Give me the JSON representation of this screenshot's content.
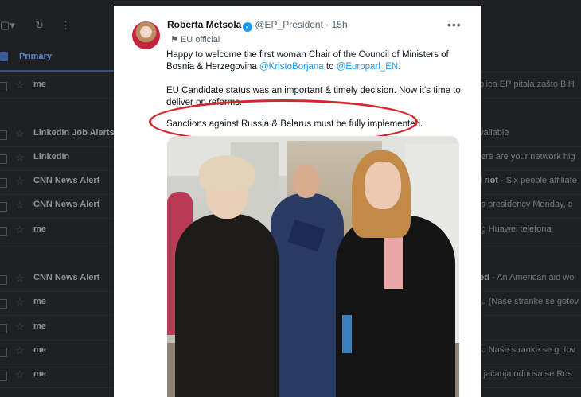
{
  "gmail": {
    "tab_primary": "Primary",
    "rows": [
      {
        "sender": "me",
        "snippet": "ablica EP pitala zašto BiH"
      },
      {
        "sender": "LinkedIn Job Alerts",
        "snippet": "available"
      },
      {
        "sender": "LinkedIn",
        "snippet": "Here are your network hig"
      },
      {
        "sender": "CNN News Alert",
        "snippet_bold": "al riot",
        "snippet": " - Six people affiliate"
      },
      {
        "sender": "CNN News Alert",
        "snippet": "his presidency Monday, c"
      },
      {
        "sender": "me",
        "snippet": "log Huawei telefona"
      },
      {
        "sender": "CNN News Alert",
        "snippet_bold": "eed",
        "snippet": " - An American aid wo"
      },
      {
        "sender": "me",
        "snippet": "blu (Naše stranke se gotov"
      },
      {
        "sender": "me",
        "snippet": ""
      },
      {
        "sender": "me",
        "snippet": "blu Naše stranke se gotov"
      },
      {
        "sender": "me",
        "snippet": "ih jačanja odnosa se Rus"
      }
    ]
  },
  "tweet": {
    "author_name": "Roberta Metsola",
    "handle": "@EP_President",
    "time": "· 15h",
    "label": "EU official",
    "line1": "Happy to welcome the first woman Chair of the Council of Ministers of",
    "line2_prefix": "Bosnia & Herzegovina ",
    "mention1": "@KristoBorjana",
    "line2_mid": " to ",
    "mention2": "@Europarl_EN",
    "line2_suffix": ".",
    "para2_line1": "EU Candidate status was an important & timely decision. Now it's time to",
    "para2_line2": "deliver on reforms.",
    "para3": "Sanctions against Russia & Belarus must be fully implemented.",
    "more_icon": "more-horizontal-icon",
    "verified_icon": "verified-badge-icon",
    "label_icon": "flag-icon"
  },
  "colors": {
    "highlight_ellipse": "#d12a2e",
    "link": "#1d9bf0",
    "gmail_bg": "#1f2021"
  }
}
